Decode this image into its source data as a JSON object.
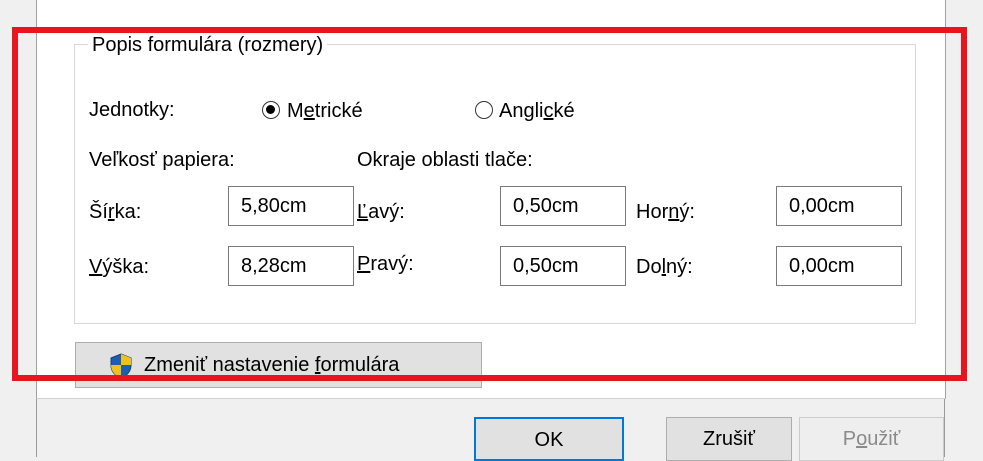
{
  "group": {
    "title": "Popis formulára (rozmery)"
  },
  "units": {
    "label": "Jednotky:",
    "metric_pre": "M",
    "metric_ul": "e",
    "metric_post": "trické",
    "english_pre": "Angli",
    "english_ul": "c",
    "english_post": "ké",
    "selected": "metric"
  },
  "paper_size": {
    "label": "Veľkosť papiera:",
    "width_pre": "Ší",
    "width_ul": "r",
    "width_post": "ka:",
    "width_value": "5,80cm",
    "height_ul": "V",
    "height_post": "ýška:",
    "height_value": "8,28cm"
  },
  "margins": {
    "label": "Okraje oblasti tlače:",
    "left_ul": "Ľ",
    "left_post": "avý:",
    "left_value": "0,50cm",
    "right_ul": "P",
    "right_post": "ravý:",
    "right_value": "0,50cm",
    "top_pre": "Hor",
    "top_ul": "n",
    "top_post": "ý:",
    "top_value": "0,00cm",
    "bottom_pre": "Do",
    "bottom_ul": "l",
    "bottom_post": "ný:",
    "bottom_value": "0,00cm"
  },
  "buttons": {
    "change_pre": "Zmeniť nastavenie ",
    "change_ul": "f",
    "change_post": "ormulára",
    "ok": "OK",
    "cancel": "Zrušiť",
    "apply_pre": "P",
    "apply_ul": "o",
    "apply_post": "užiť"
  },
  "colors": {
    "highlight_frame": "#e8141e",
    "default_button_border": "#0078d7"
  }
}
